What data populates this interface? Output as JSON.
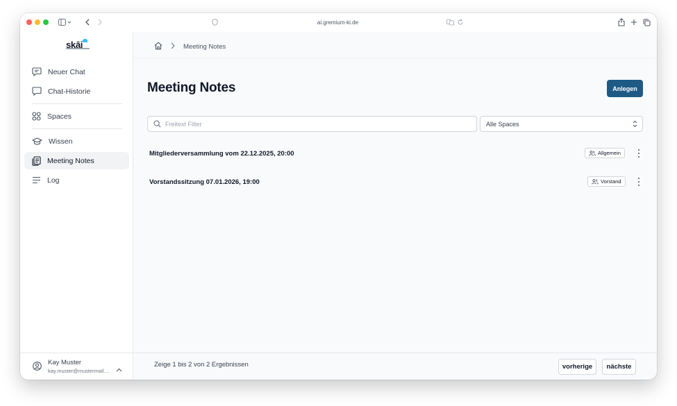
{
  "browser": {
    "url": "ai.gremium-ki.de"
  },
  "sidebar": {
    "logo_text": "skāi",
    "items": [
      {
        "label": "Neuer Chat",
        "icon": "chat-plus-icon"
      },
      {
        "label": "Chat-Historie",
        "icon": "chat-bubble-icon"
      },
      {
        "label": "Spaces",
        "icon": "grid-icon"
      },
      {
        "label": "Wissen",
        "icon": "graduation-cap-icon"
      },
      {
        "label": "Meeting Notes",
        "icon": "notes-icon",
        "active": true
      },
      {
        "label": "Log",
        "icon": "lines-icon"
      }
    ],
    "user": {
      "name": "Kay Muster",
      "email": "kay.muster@mustermail...."
    }
  },
  "breadcrumb": {
    "current": "Meeting Notes"
  },
  "page": {
    "title": "Meeting Notes",
    "create_label": "Anlegen"
  },
  "filters": {
    "search_placeholder": "Freitext Filter",
    "search_value": "",
    "space_selected": "Alle Spaces"
  },
  "meetings": [
    {
      "title": "Mitgliederversammlung vom 22.12.2025, 20:00",
      "space": "Allgemein"
    },
    {
      "title": "Vorstandssitzung 07.01.2026, 19:00",
      "space": "Vorstand"
    }
  ],
  "pagination": {
    "summary": "Zeige 1 bis 2 von 2 Ergebnissen",
    "prev_label": "vorherige",
    "next_label": "nächste"
  },
  "colors": {
    "primary": "#1e5a85",
    "active_nav": "#f1f3f5",
    "background": "#f8fafc"
  }
}
